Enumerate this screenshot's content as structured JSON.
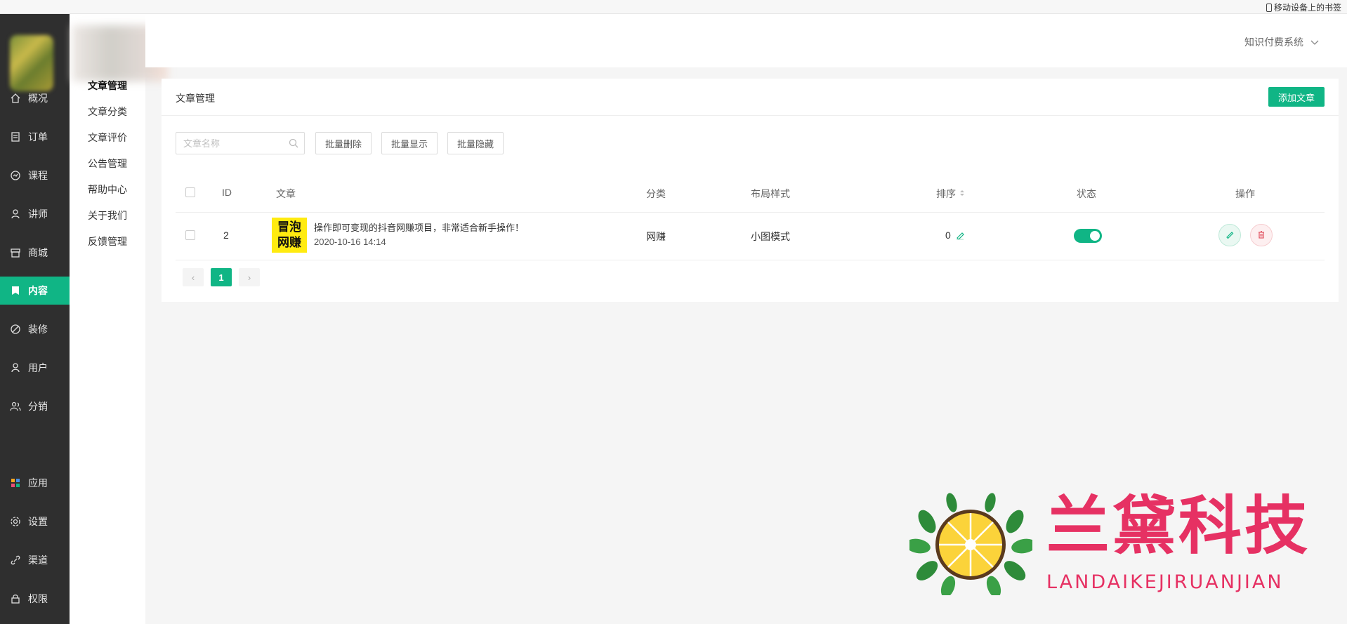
{
  "browser": {
    "bookmark_label": "移动设备上的书签"
  },
  "sidebar": {
    "items": [
      {
        "label": "概况",
        "icon": "home-icon"
      },
      {
        "label": "订单",
        "icon": "order-icon"
      },
      {
        "label": "课程",
        "icon": "course-icon"
      },
      {
        "label": "讲师",
        "icon": "teacher-icon"
      },
      {
        "label": "商城",
        "icon": "store-icon"
      },
      {
        "label": "内容",
        "icon": "content-icon",
        "active": true
      },
      {
        "label": "装修",
        "icon": "decorate-icon"
      },
      {
        "label": "用户",
        "icon": "user-icon"
      },
      {
        "label": "分销",
        "icon": "distribution-icon"
      },
      {
        "label": "应用",
        "icon": "apps-icon"
      },
      {
        "label": "设置",
        "icon": "gear-icon"
      },
      {
        "label": "渠道",
        "icon": "channel-icon"
      },
      {
        "label": "权限",
        "icon": "lock-icon"
      }
    ]
  },
  "subnav": {
    "items": [
      {
        "label": "文章管理",
        "active": true
      },
      {
        "label": "文章分类"
      },
      {
        "label": "文章评价"
      },
      {
        "label": "公告管理"
      },
      {
        "label": "帮助中心"
      },
      {
        "label": "关于我们"
      },
      {
        "label": "反馈管理"
      }
    ]
  },
  "header": {
    "system_label": "知识付费系统"
  },
  "card": {
    "title": "文章管理",
    "add_button": "添加文章",
    "search_placeholder": "文章名称",
    "batch_delete": "批量删除",
    "batch_show": "批量显示",
    "batch_hide": "批量隐藏"
  },
  "table": {
    "columns": {
      "id": "ID",
      "article": "文章",
      "category": "分类",
      "layout": "布局样式",
      "sort": "排序",
      "status": "状态",
      "actions": "操作"
    },
    "rows": [
      {
        "id": "2",
        "thumb_line1": "冒泡",
        "thumb_line2": "网赚",
        "title": "操作即可变现的抖音网赚项目，非常适合新手操作！",
        "date": "2020-10-16 14:14",
        "category": "网赚",
        "layout": "小图模式",
        "sort": "0",
        "status_on": true
      }
    ]
  },
  "pagination": {
    "prev": "‹",
    "current": "1",
    "next": "›"
  },
  "watermark": {
    "title": "兰黛科技",
    "subtitle": "LANDAIKEJIRUANJIAN"
  },
  "colors": {
    "accent": "#10b585",
    "danger": "#e0505f",
    "watermark": "#e63163"
  }
}
